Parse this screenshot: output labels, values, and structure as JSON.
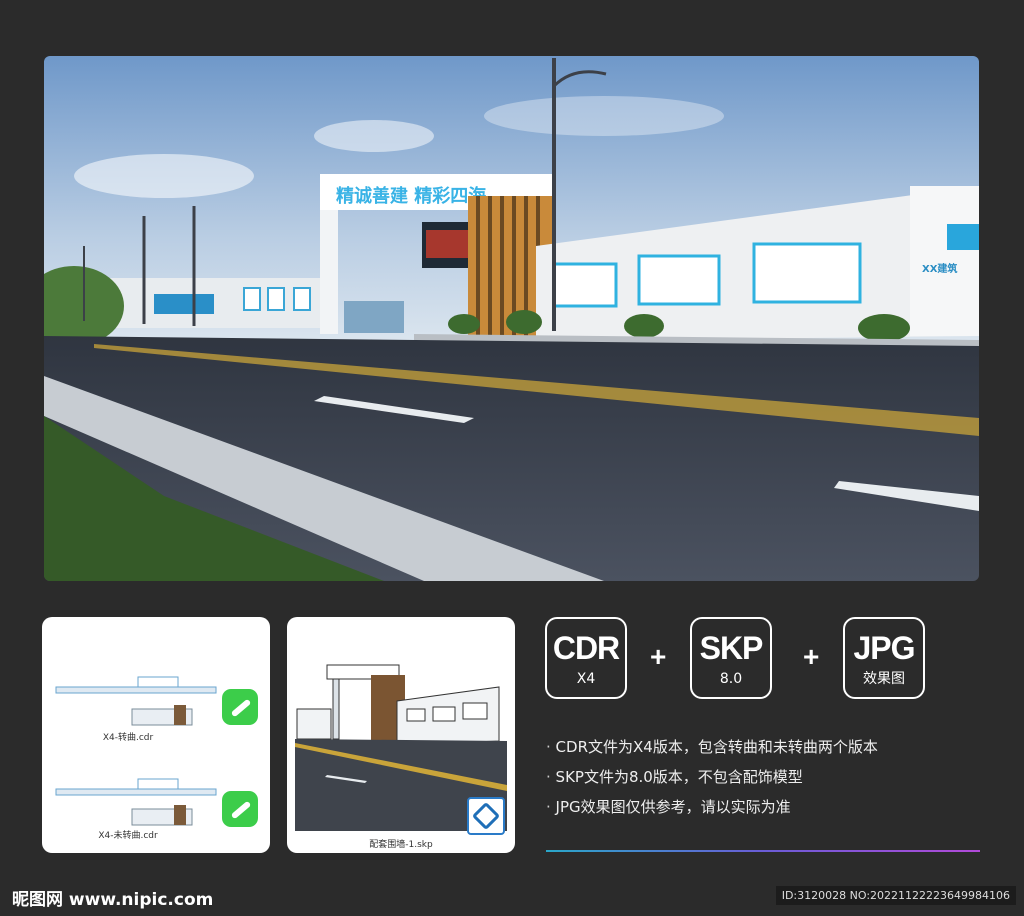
{
  "hero": {
    "gate_slogan": "精诚善建 精彩四海",
    "wall_company_text": "XX建筑",
    "wall_slogan_left": "精诚善建 精彩四海"
  },
  "thumbnails": [
    {
      "caption_1": "X4-转曲.cdr",
      "caption_2": "X4-未转曲.cdr",
      "icon": "coreldraw-icon"
    },
    {
      "caption": "配套围墙-1.skp",
      "icon": "sketchup-icon"
    }
  ],
  "formats": [
    {
      "name": "CDR",
      "sub": "X4"
    },
    {
      "name": "SKP",
      "sub": "8.0"
    },
    {
      "name": "JPG",
      "sub": "效果图"
    }
  ],
  "plus": "+",
  "notes": [
    "CDR文件为X4版本，包含转曲和未转曲两个版本",
    "SKP文件为8.0版本，不包含配饰模型",
    "JPG效果图仅供参考，请以实际为准"
  ],
  "footer": {
    "brand_cn": "昵图网",
    "brand_url": "www.nipic.com",
    "id_text": "ID:3120028 NO:20221122223649984106"
  },
  "colors": {
    "background": "#2b2b2b",
    "accent_blue": "#2aa7c9",
    "accent_purple": "#b24ad9"
  }
}
